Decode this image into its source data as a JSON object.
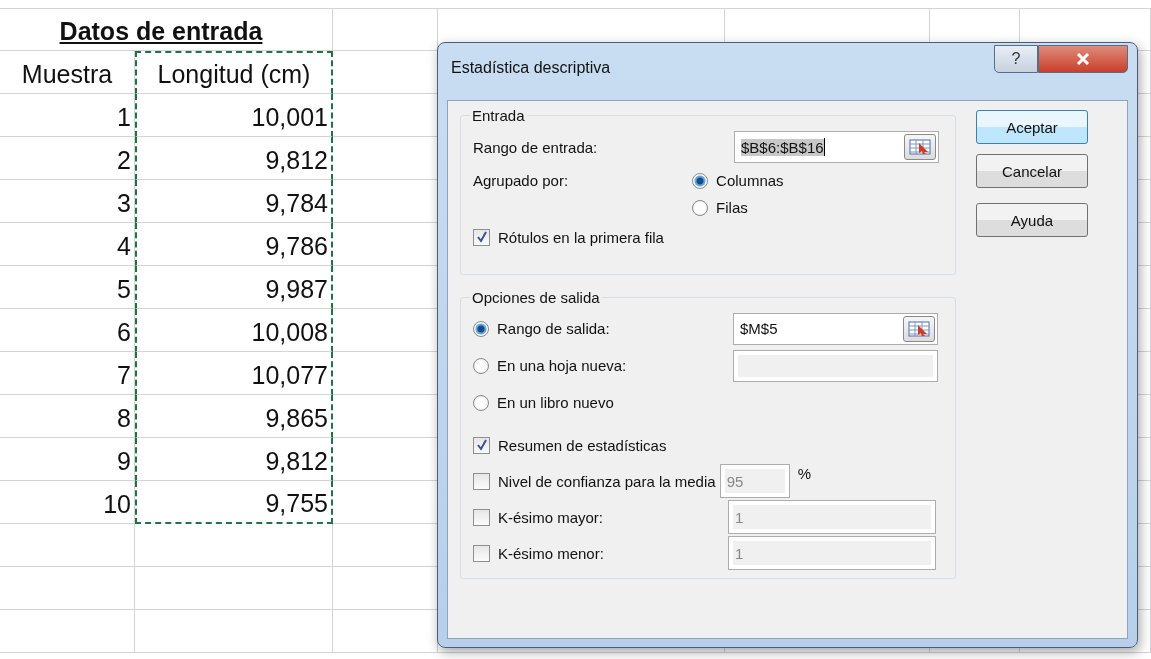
{
  "sheet": {
    "title": "Datos de entrada",
    "columns": [
      "Muestra",
      "Longitud (cm)"
    ],
    "rows": [
      [
        "1",
        "10,001"
      ],
      [
        "2",
        "9,812"
      ],
      [
        "3",
        "9,784"
      ],
      [
        "4",
        "9,786"
      ],
      [
        "5",
        "9,987"
      ],
      [
        "6",
        "10,008"
      ],
      [
        "7",
        "10,077"
      ],
      [
        "8",
        "9,865"
      ],
      [
        "9",
        "9,812"
      ],
      [
        "10",
        "9,755"
      ]
    ]
  },
  "dialog": {
    "title": "Estadística descriptiva",
    "help_button": "?",
    "input_group": {
      "title": "Entrada",
      "range_label": "Rango de entrada:",
      "range_value": "$B$6:$B$16",
      "range_text_selected": true,
      "group_by_label": "Agrupado por:",
      "group_by_options": [
        {
          "label": "Columnas",
          "selected": true
        },
        {
          "label": "Filas",
          "selected": false
        }
      ],
      "labels_checkbox": {
        "label": "Rótulos en la primera fila",
        "checked": true
      }
    },
    "output_group": {
      "title": "Opciones de salida",
      "destinations": [
        {
          "kind": "range",
          "label": "Rango de salida:",
          "selected": true,
          "value": "$M$5"
        },
        {
          "kind": "field",
          "label": "En una hoja nueva:",
          "selected": false
        },
        {
          "kind": "plain",
          "label": "En un libro nuevo",
          "selected": false
        }
      ],
      "options": [
        {
          "kind": "check",
          "label": "Resumen de estadísticas",
          "checked": true
        },
        {
          "kind": "confidence",
          "label": "Nivel de confianza para la media",
          "checked": false,
          "value": "95",
          "unit": "%"
        },
        {
          "kind": "rank",
          "label": "K-ésimo mayor:",
          "checked": false,
          "value": "1"
        },
        {
          "kind": "rank",
          "label": "K-ésimo menor:",
          "checked": false,
          "value": "1"
        }
      ]
    },
    "buttons": [
      {
        "label": "Aceptar",
        "default": true
      },
      {
        "label": "Cancelar",
        "default": false
      },
      {
        "label": "Ayuda",
        "default": false
      }
    ]
  }
}
